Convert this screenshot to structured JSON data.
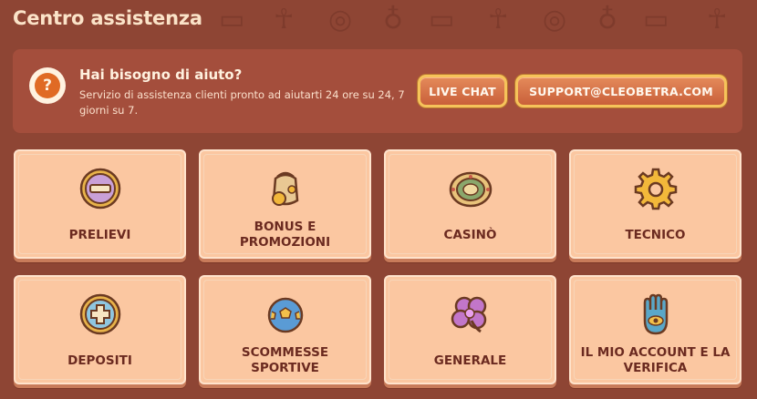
{
  "page": {
    "title": "Centro assistenza"
  },
  "help": {
    "icon": "question-mark-icon",
    "title": "Hai bisogno di aiuto?",
    "description": "Servizio di assistenza clienti pronto ad aiutarti 24 ore su 24, 7 giorni su 7.",
    "live_chat_label": "LIVE CHAT",
    "email_label": "SUPPORT@CLEOBETRA.COM"
  },
  "categories": [
    {
      "label": "PRELIEVI",
      "icon": "withdrawal-icon"
    },
    {
      "label": "BONUS E PROMOZIONI",
      "icon": "bonus-pot-icon"
    },
    {
      "label": "CASINÒ",
      "icon": "casino-chip-icon"
    },
    {
      "label": "TECNICO",
      "icon": "gear-icon"
    },
    {
      "label": "DEPOSITI",
      "icon": "deposit-plus-icon"
    },
    {
      "label": "SCOMMESSE SPORTIVE",
      "icon": "soccer-ball-icon"
    },
    {
      "label": "GENERALE",
      "icon": "clover-icon"
    },
    {
      "label": "IL MIO ACCOUNT E LA VERIFICA",
      "icon": "hamsa-hand-icon"
    }
  ],
  "colors": {
    "background": "#8e4534",
    "panel": "#a44e3c",
    "card": "#fbc7a1",
    "accent": "#e06a24",
    "button_border": "#f6c35a"
  }
}
